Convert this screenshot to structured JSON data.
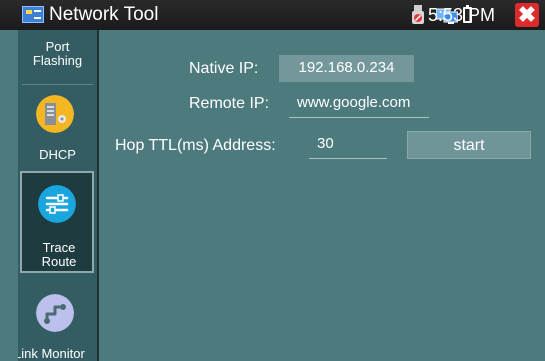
{
  "app": {
    "title": "Network Tool",
    "clock": "5:53 PM",
    "close_glyph": "✖",
    "accent_color": "#4d7a7d",
    "close_color": "#dd2a2a"
  },
  "sidebar": {
    "items": [
      {
        "label_line1": "Port",
        "label_line2": "Flashing",
        "icon": "port-flashing-icon"
      },
      {
        "label_line1": "DHCP",
        "icon": "dhcp-icon"
      },
      {
        "label_line1": "Trace",
        "label_line2": "Route",
        "icon": "trace-route-icon",
        "selected": true
      },
      {
        "label_line1": "Link Monitor",
        "icon": "link-monitor-icon"
      }
    ]
  },
  "form": {
    "native_ip_label": "Native IP:",
    "native_ip_value": "192.168.0.234",
    "remote_ip_label": "Remote IP:",
    "remote_ip_value": "www.google.com",
    "hop_label": "Hop TTL(ms) Address:",
    "hop_value": "30",
    "start_label": "start"
  }
}
